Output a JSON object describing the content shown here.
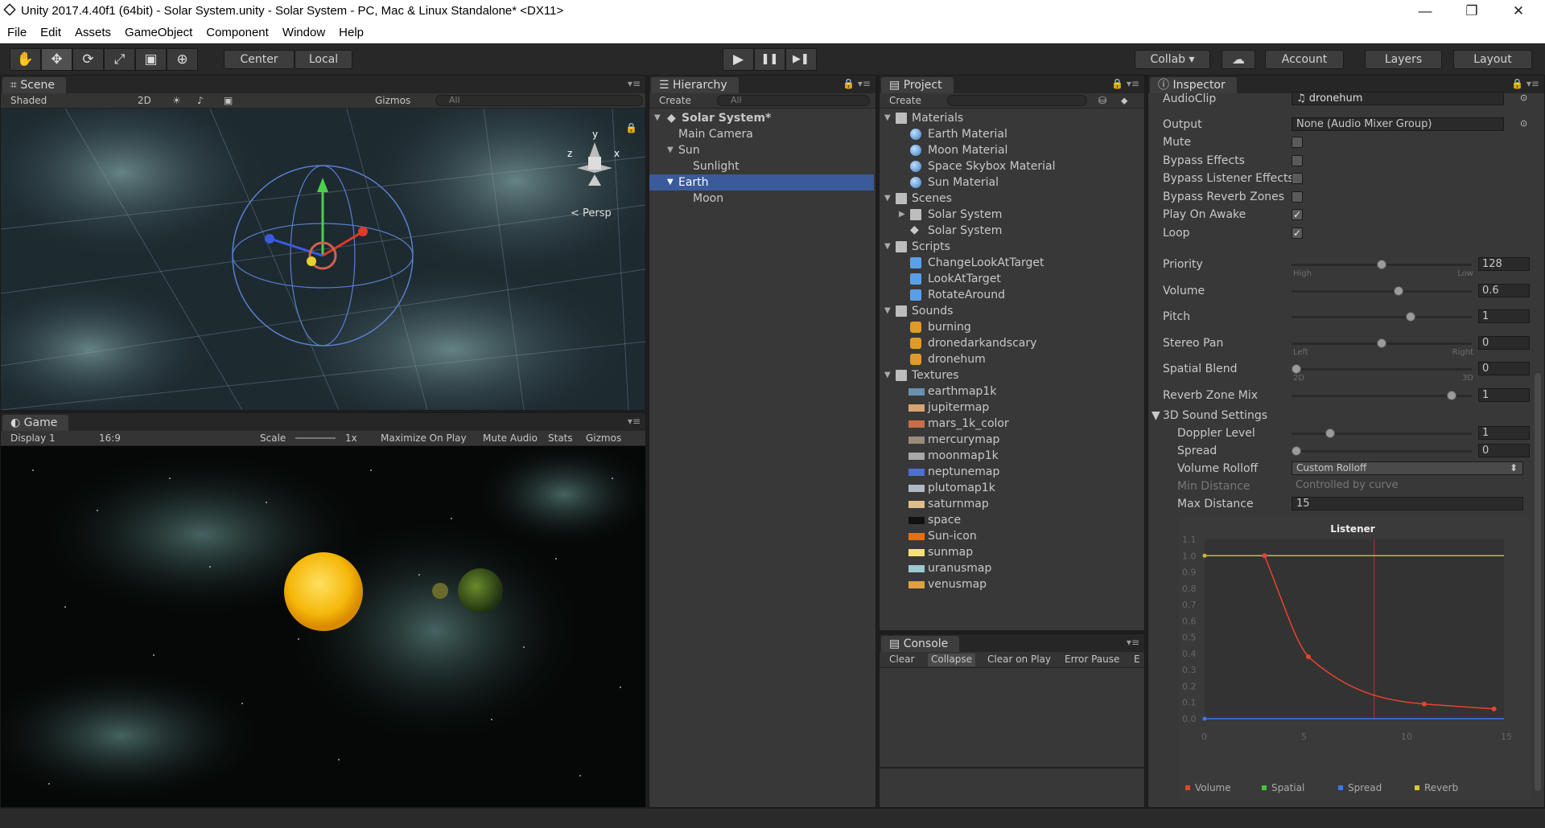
{
  "window": {
    "title": "Unity 2017.4.40f1 (64bit) - Solar System.unity - Solar System - PC, Mac & Linux Standalone* <DX11>",
    "min": "—",
    "max": "❐",
    "close": "✕"
  },
  "menu": [
    "File",
    "Edit",
    "Assets",
    "GameObject",
    "Component",
    "Window",
    "Help"
  ],
  "toolbar": {
    "center": "Center",
    "local": "Local",
    "collab": "Collab ▾",
    "account": "Account",
    "layers": "Layers",
    "layout": "Layout",
    "icons": {
      "hand": "✋",
      "move": "✥",
      "rotate": "⟳",
      "scale": "⤢",
      "rect": "▣",
      "transform": "⊕",
      "play": "▶",
      "pause": "❚❚",
      "step": "▶❚",
      "cloud": "☁"
    }
  },
  "scene": {
    "tab": "Scene",
    "shading": "Shaded",
    "mode2d": "2D",
    "gizmos": "Gizmos",
    "search": "All",
    "persp": "< Persp",
    "axes": {
      "y": "y",
      "x": "x",
      "z": "z"
    }
  },
  "game": {
    "tab": "Game",
    "display": "Display 1",
    "aspect": "16:9",
    "scale_label": "Scale",
    "scale_value": "1x",
    "maximize": "Maximize On Play",
    "mute": "Mute Audio",
    "stats": "Stats",
    "gizmos": "Gizmos"
  },
  "hierarchy": {
    "tab": "Hierarchy",
    "create": "Create",
    "search": "All",
    "root": "Solar System*",
    "items": [
      "Main Camera",
      "Sun",
      "Sunlight",
      "Earth",
      "Moon"
    ]
  },
  "project": {
    "tab": "Project",
    "create": "Create",
    "folders": [
      {
        "name": "Materials",
        "items": [
          "Earth Material",
          "Moon Material",
          "Space Skybox Material",
          "Sun Material"
        ]
      },
      {
        "name": "Scenes",
        "items": [
          "Solar System",
          "Solar System"
        ]
      },
      {
        "name": "Scripts",
        "items": [
          "ChangeLookAtTarget",
          "LookAtTarget",
          "RotateAround"
        ]
      },
      {
        "name": "Sounds",
        "items": [
          "burning",
          "dronedarkandscary",
          "dronehum"
        ]
      },
      {
        "name": "Textures",
        "items": [
          "earthmap1k",
          "jupitermap",
          "mars_1k_color",
          "mercurymap",
          "moonmap1k",
          "neptunemap",
          "plutomap1k",
          "saturnmap",
          "space",
          "Sun-icon",
          "sunmap",
          "uranusmap",
          "venusmap"
        ]
      }
    ],
    "texture_colors": [
      "#6b8fb0",
      "#d7a46e",
      "#c77046",
      "#9c8a7a",
      "#a8a8a8",
      "#4e6fd6",
      "#b0b8c8",
      "#dcbf8a",
      "#111111",
      "#e8700a",
      "#f6e07a",
      "#9cc8d0",
      "#e0a040"
    ]
  },
  "console": {
    "tab": "Console",
    "buttons": [
      "Clear",
      "Collapse",
      "Clear on Play",
      "Error Pause",
      "E"
    ]
  },
  "inspector": {
    "tab": "Inspector",
    "audioclip_label": "AudioClip",
    "audioclip_value": "dronehum",
    "output_label": "Output",
    "output_value": "None (Audio Mixer Group)",
    "checks": [
      {
        "label": "Mute",
        "checked": false
      },
      {
        "label": "Bypass Effects",
        "checked": false
      },
      {
        "label": "Bypass Listener Effects",
        "checked": false
      },
      {
        "label": "Bypass Reverb Zones",
        "checked": false
      },
      {
        "label": "Play On Awake",
        "checked": true
      },
      {
        "label": "Loop",
        "checked": true
      }
    ],
    "check_mark": "✓",
    "sliders": [
      {
        "label": "Priority",
        "value": "128",
        "fraction": 0.5,
        "left": "High",
        "right": "Low"
      },
      {
        "label": "Volume",
        "value": "0.6",
        "fraction": 0.6,
        "left": "",
        "right": ""
      },
      {
        "label": "Pitch",
        "value": "1",
        "fraction": 0.67,
        "left": "",
        "right": ""
      },
      {
        "label": "Stereo Pan",
        "value": "0",
        "fraction": 0.5,
        "left": "Left",
        "right": "Right"
      },
      {
        "label": "Spatial Blend",
        "value": "0",
        "fraction": 0,
        "left": "2D",
        "right": "3D"
      },
      {
        "label": "Reverb Zone Mix",
        "value": "1",
        "fraction": 0.91,
        "left": "",
        "right": ""
      }
    ],
    "sound3d": "3D Sound Settings",
    "doppler": {
      "label": "Doppler Level",
      "value": "1",
      "fraction": 0.2
    },
    "spread": {
      "label": "Spread",
      "value": "0",
      "fraction": 0
    },
    "rolloff": {
      "label": "Volume Rolloff",
      "value": "Custom Rolloff"
    },
    "min_distance": {
      "label": "Min Distance",
      "value": "Controlled by curve"
    },
    "max_distance": {
      "label": "Max Distance",
      "value": "15"
    },
    "graph": {
      "title": "Listener",
      "y_ticks": [
        "1.1",
        "1.0",
        "0.9",
        "0.8",
        "0.7",
        "0.6",
        "0.5",
        "0.4",
        "0.3",
        "0.2",
        "0.1",
        "0.0"
      ],
      "x_ticks": [
        "0",
        "5",
        "10",
        "15"
      ],
      "legend": [
        {
          "name": "Volume",
          "color": "#e8442a"
        },
        {
          "name": "Spatial",
          "color": "#3ec83e"
        },
        {
          "name": "Spread",
          "color": "#3a78e8"
        },
        {
          "name": "Reverb",
          "color": "#d6c92a"
        }
      ],
      "volume_curve": [
        [
          3,
          1
        ],
        [
          5.2,
          0.38
        ],
        [
          11,
          0.09
        ],
        [
          14.5,
          0.06
        ]
      ],
      "reverb_level": 1,
      "spread_level": 0,
      "listener_distance": 8.5
    }
  }
}
